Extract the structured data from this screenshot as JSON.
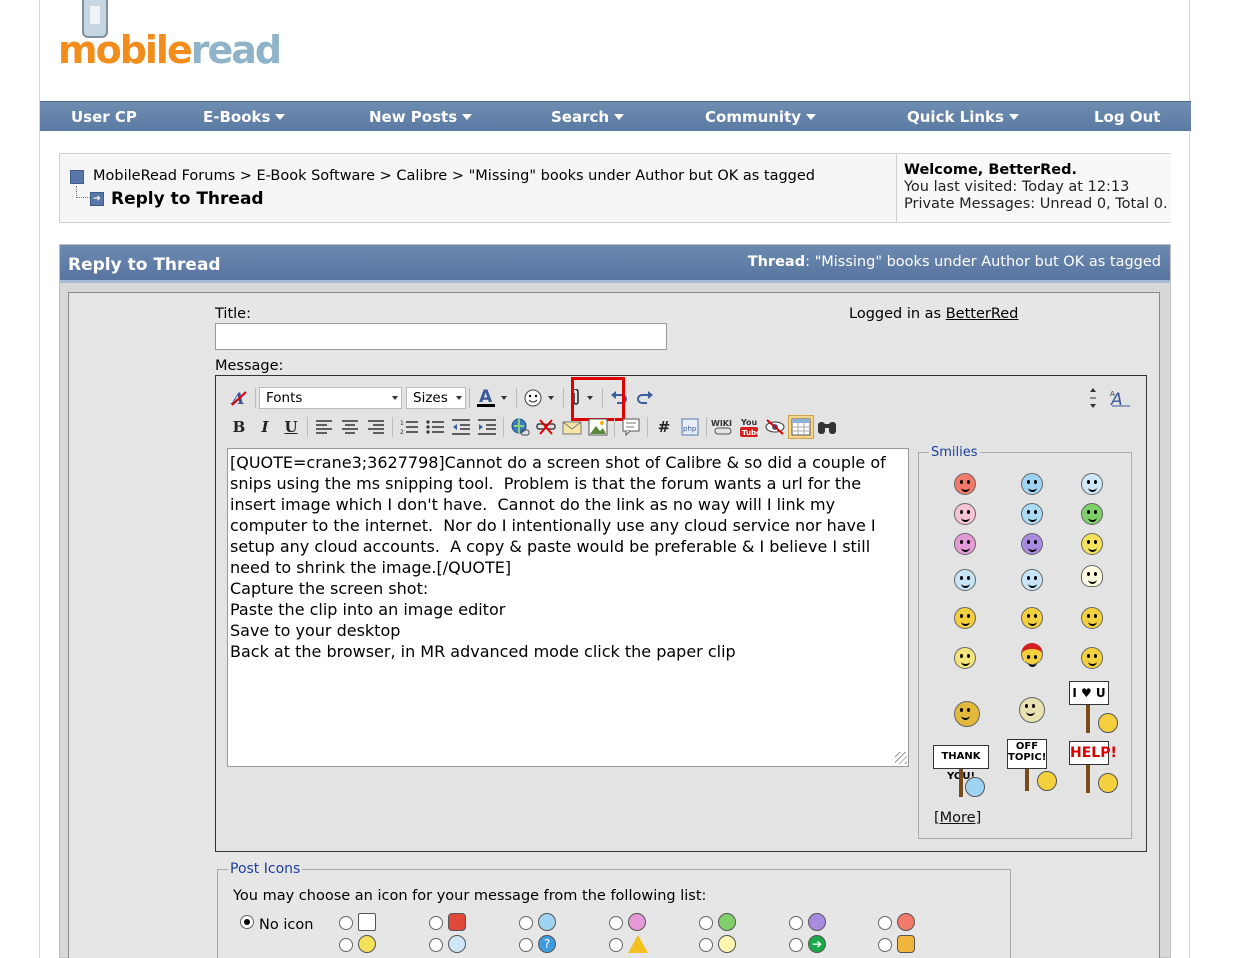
{
  "logo": {
    "part1": "mobile",
    "part2": "read"
  },
  "nav": [
    {
      "label": "User CP",
      "dropdown": false
    },
    {
      "label": "E-Books",
      "dropdown": true
    },
    {
      "label": "New Posts",
      "dropdown": true
    },
    {
      "label": "Search",
      "dropdown": true
    },
    {
      "label": "Community",
      "dropdown": true
    },
    {
      "label": "Quick Links",
      "dropdown": true
    },
    {
      "label": "Log Out",
      "dropdown": false
    }
  ],
  "breadcrumb": {
    "items": [
      "MobileRead Forums",
      "E-Book Software",
      "Calibre",
      "\"Missing\" books under Author but OK as tagged"
    ],
    "separator": ">",
    "current": "Reply to Thread"
  },
  "welcome": {
    "greeting": "Welcome, BetterRed.",
    "last_visit_label": "You last visited:",
    "last_visit_value": "Today at 12:13",
    "pm_label": "Private Messages:",
    "pm_value": "Unread 0, Total 0."
  },
  "reply": {
    "heading": "Reply to Thread",
    "thread_label": "Thread",
    "thread_title": ": \"Missing\" books under Author but OK as tagged",
    "title_label": "Title:",
    "title_value": "",
    "logged_in_label": "Logged in as",
    "logged_in_user": "BetterRed",
    "message_label": "Message:"
  },
  "toolbar": {
    "font_select": "Fonts",
    "size_select": "Sizes"
  },
  "message_text": "[QUOTE=crane3;3627798]Cannot do a screen shot of Calibre & so did a couple of snips using the ms snipping tool.  Problem is that the forum wants a url for the insert image which I don't have.  Cannot do the link as no way will I link my computer to the internet.  Nor do I intentionally use any cloud service nor have I setup any cloud accounts.  A copy & paste would be preferable & I believe I still need to shrink the image.[/QUOTE]\nCapture the screen shot:\nPaste the clip into an image editor\nSave to your desktop\nBack at the browser, in MR advanced mode click the paper clip",
  "smilies": {
    "legend": "Smilies",
    "more": "[More]",
    "signs": [
      "THANK YOU!",
      "OFF TOPIC!",
      "HELP!",
      "I ♥ U"
    ]
  },
  "post_icons": {
    "legend": "Post Icons",
    "instruction": "You may choose an icon for your message from the following list:",
    "no_icon_label": "No icon"
  },
  "colors": {
    "nav_bg": "#5f7ea8",
    "highlight": "#e00000",
    "link": "#1e3e9e"
  }
}
